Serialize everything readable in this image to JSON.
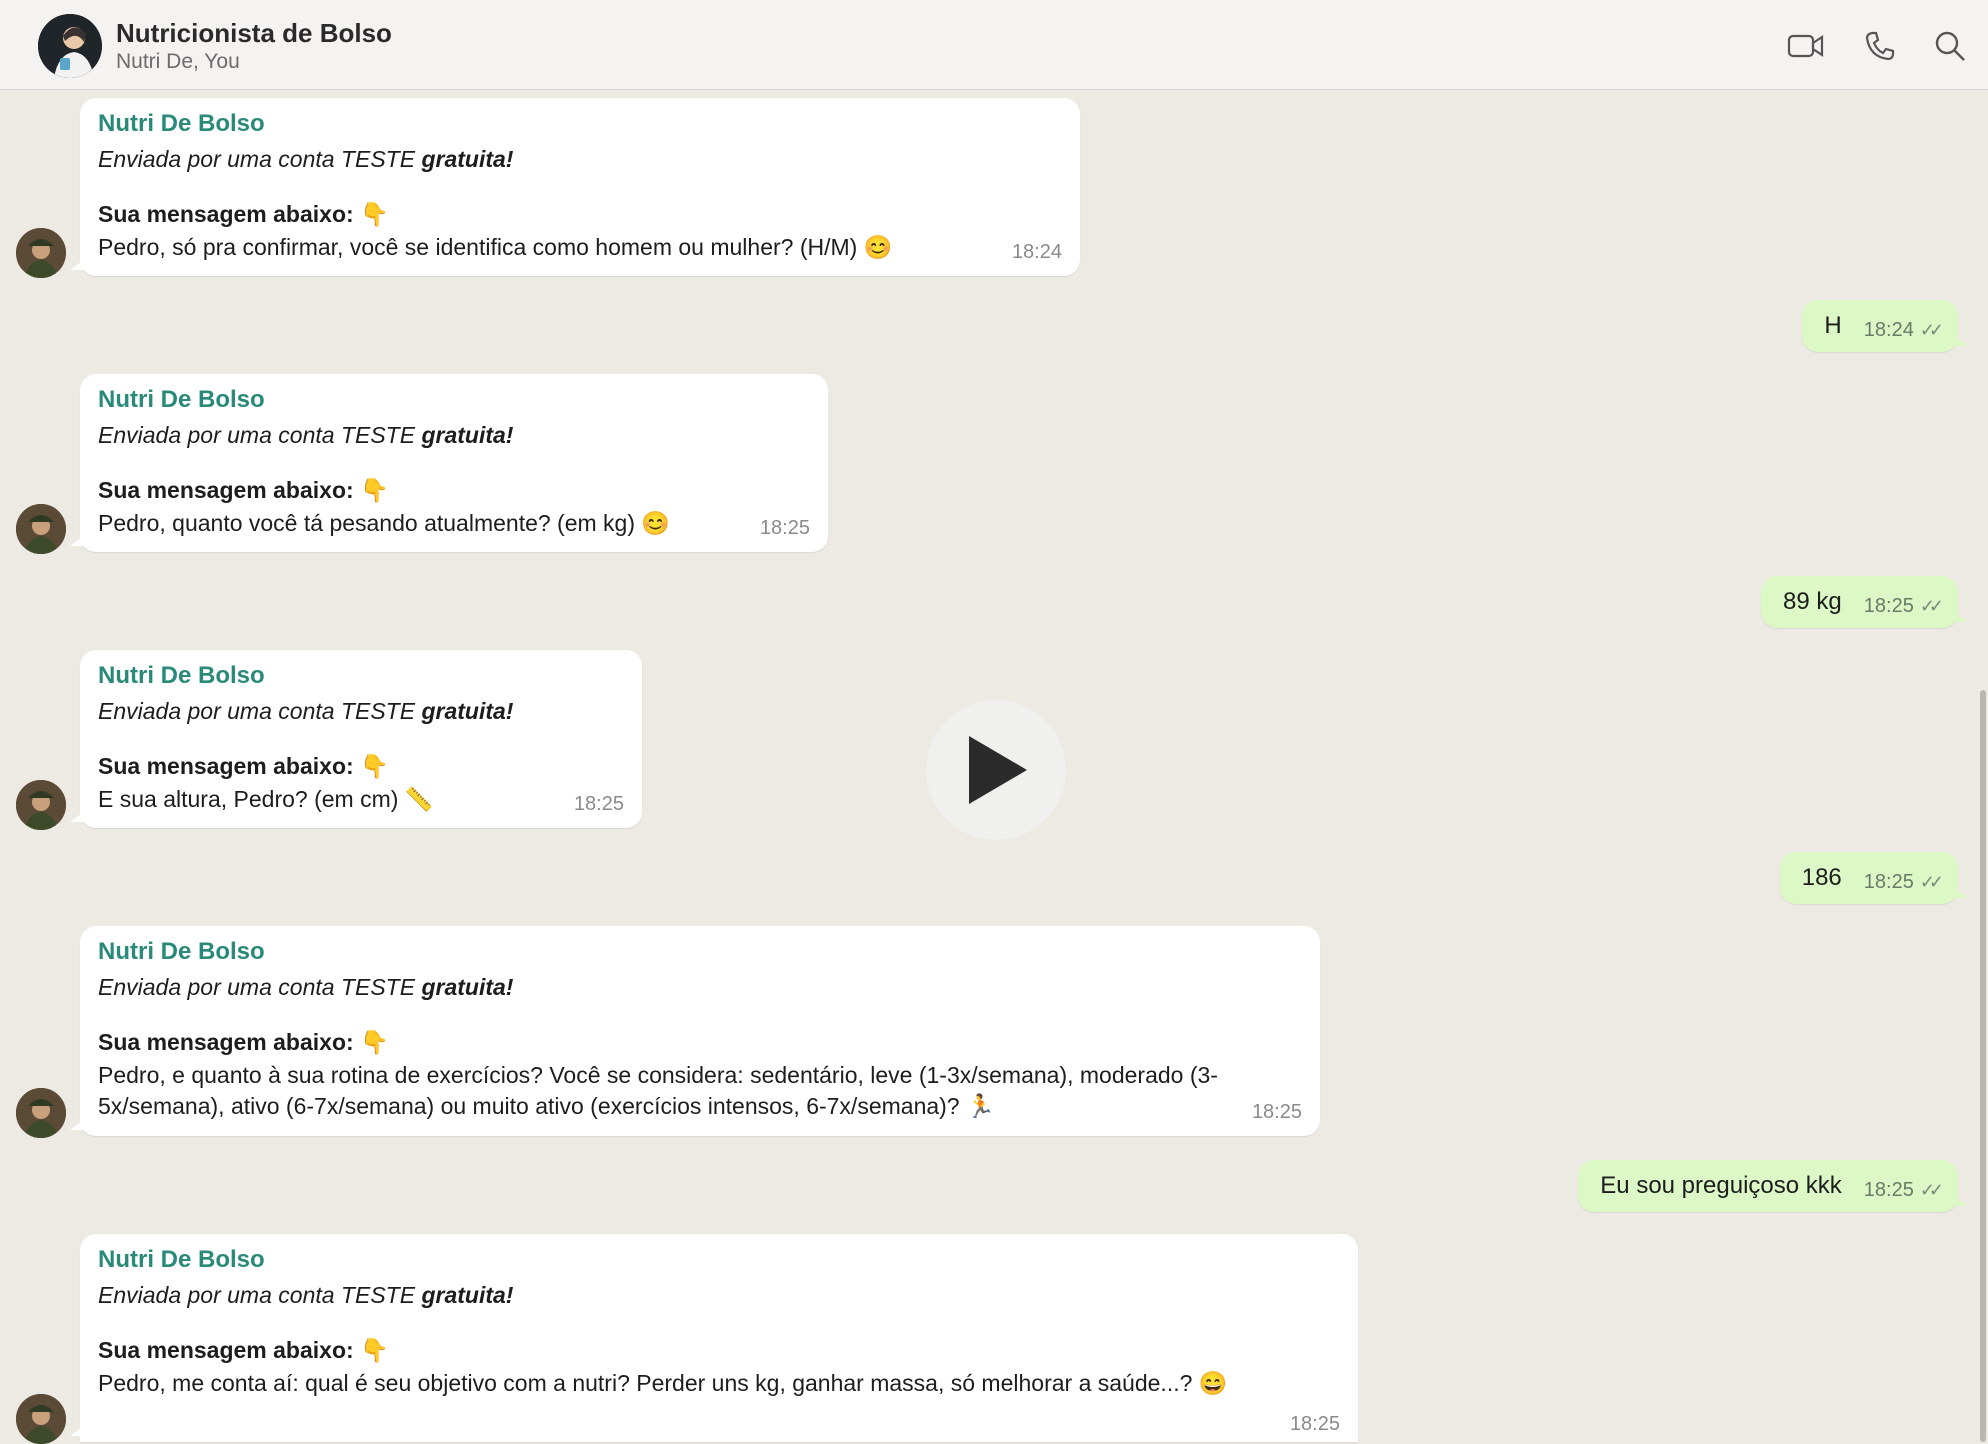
{
  "header": {
    "title": "Nutricionista de Bolso",
    "subtitle": "Nutri De, You",
    "icons": [
      "video-call-icon",
      "phone-icon",
      "search-icon"
    ]
  },
  "messages": [
    {
      "direction": "in",
      "sender": "Nutri De Bolso",
      "line1_italic": "Enviada por uma conta TESTE ",
      "line1_bold": "gratuita!",
      "label": "Sua mensagem abaixo:",
      "label_emoji": "👇",
      "text": "Pedro, só pra confirmar, você se identifica como homem ou mulher? (H/M) 😊",
      "time": "18:24"
    },
    {
      "direction": "out",
      "text": "H",
      "time": "18:24",
      "ticks": "✓✓"
    },
    {
      "direction": "in",
      "sender": "Nutri De Bolso",
      "line1_italic": "Enviada por uma conta TESTE ",
      "line1_bold": "gratuita!",
      "label": "Sua mensagem abaixo:",
      "label_emoji": "👇",
      "text": "Pedro, quanto você tá pesando atualmente? (em kg) 😊",
      "time": "18:25"
    },
    {
      "direction": "out",
      "text": "89 kg",
      "time": "18:25",
      "ticks": "✓✓"
    },
    {
      "direction": "in",
      "sender": "Nutri De Bolso",
      "line1_italic": "Enviada por uma conta TESTE ",
      "line1_bold": "gratuita!",
      "label": "Sua mensagem abaixo:",
      "label_emoji": "👇",
      "text": "E sua altura, Pedro? (em cm) 📏",
      "time": "18:25"
    },
    {
      "direction": "out",
      "text": "186",
      "time": "18:25",
      "ticks": "✓✓"
    },
    {
      "direction": "in",
      "sender": "Nutri De Bolso",
      "line1_italic": "Enviada por uma conta TESTE ",
      "line1_bold": "gratuita!",
      "label": "Sua mensagem abaixo:",
      "label_emoji": "👇",
      "text": "Pedro, e quanto à sua rotina de exercícios? Você se considera: sedentário, leve (1-3x/semana), moderado (3-5x/semana), ativo (6-7x/semana) ou muito ativo (exercícios intensos, 6-7x/semana)? 🏃",
      "time": "18:25"
    },
    {
      "direction": "out",
      "text": "Eu sou preguiçoso kkk",
      "time": "18:25",
      "ticks": "✓✓"
    },
    {
      "direction": "in",
      "sender": "Nutri De Bolso",
      "line1_italic": "Enviada por uma conta TESTE ",
      "line1_bold": "gratuita!",
      "label": "Sua mensagem abaixo:",
      "label_emoji": "👇",
      "text": "Pedro, me conta aí: qual é seu objetivo com a nutri? Perder uns kg, ganhar massa, só melhorar a saúde...? 😄",
      "time": "18:25"
    }
  ],
  "overlay": {
    "icon": "play-icon"
  }
}
